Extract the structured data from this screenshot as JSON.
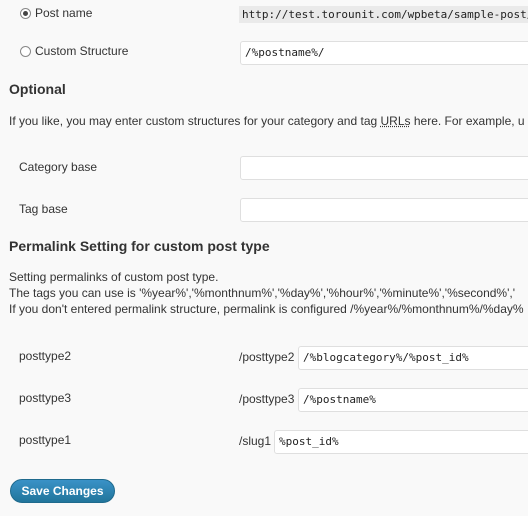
{
  "structure": {
    "post_name": {
      "label": "Post name",
      "example": "http://test.torounit.com/wpbeta/sample-post/",
      "checked": true
    },
    "custom": {
      "label": "Custom Structure",
      "value": "/%postname%/",
      "checked": false
    }
  },
  "optional": {
    "heading": "Optional",
    "description_prefix": "If you like, you may enter custom structures for your category and tag ",
    "description_link": "URLs",
    "description_suffix": " here. For example, u",
    "category_base_label": "Category base",
    "category_base_value": "",
    "tag_base_label": "Tag base",
    "tag_base_value": ""
  },
  "custom_post_type": {
    "heading": "Permalink Setting for custom post type",
    "line1": "Setting permalinks of custom post type.",
    "line2": "The tags you can use is '%year%','%monthnum%','%day%','%hour%','%minute%','%second%','",
    "line3": "If you don't entered permalink structure, permalink is configured /%year%/%monthnum%/%day%",
    "rows": [
      {
        "label": "posttype2",
        "prefix": "/posttype2",
        "value": "/%blogcategory%/%post_id%"
      },
      {
        "label": "posttype3",
        "prefix": "/posttype3",
        "value": "/%postname%"
      },
      {
        "label": "posttype1",
        "prefix": "/slug1",
        "value": "%post_id%"
      }
    ]
  },
  "save_button": "Save Changes"
}
